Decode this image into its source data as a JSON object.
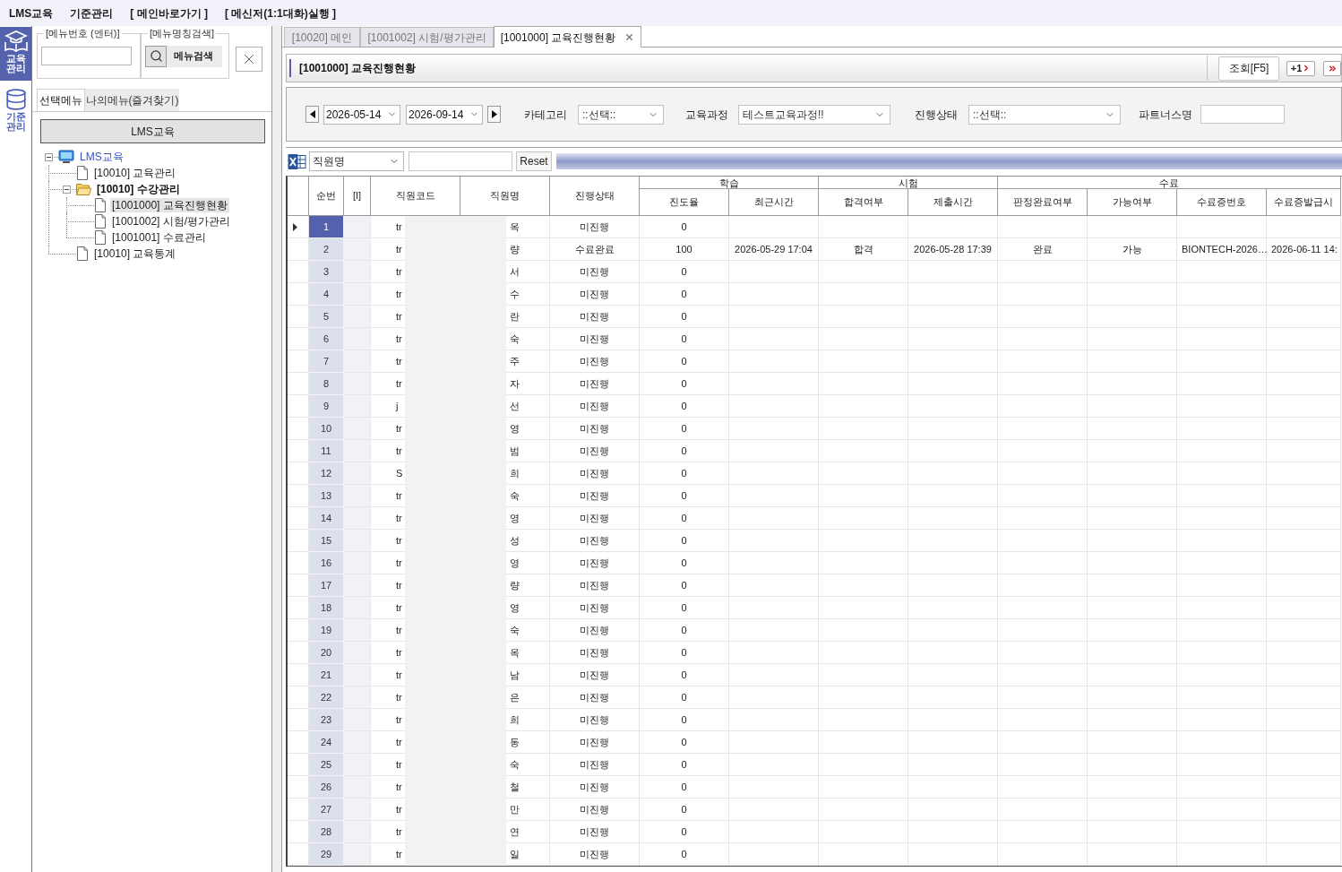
{
  "menubar": [
    "LMS교육",
    "기준관리",
    "[ 메인바로가기 ]",
    "[ 메신저(1:1대화)실행 ]"
  ],
  "nav_rail": [
    {
      "label": "교육관리",
      "selected": true
    },
    {
      "label": "기준관리",
      "selected": false
    }
  ],
  "menu_panel": {
    "menu_number": {
      "label": "[메뉴번호 (엔터)]"
    },
    "menu_search": {
      "label": "[메뉴명칭검색]",
      "button": "메뉴검색"
    },
    "tabs": [
      {
        "label": "선택메뉴",
        "selected": true
      },
      {
        "label": "나의메뉴(즐겨찾기)",
        "selected": false
      }
    ],
    "module_button": "LMS교육",
    "tree": [
      {
        "label": "LMS교육",
        "kind": "root",
        "expanded": true,
        "selected": false,
        "children": [
          {
            "label": "[10010] 교육관리",
            "kind": "page",
            "selected": false
          },
          {
            "label": "[10010] 수강관리",
            "kind": "folder",
            "expanded": true,
            "selected": false,
            "children": [
              {
                "label": "[1001000] 교육진행현황",
                "kind": "page",
                "selected": true
              },
              {
                "label": "[1001002] 시험/평가관리",
                "kind": "page",
                "selected": false
              },
              {
                "label": "[1001001] 수료관리",
                "kind": "page",
                "selected": false
              }
            ]
          },
          {
            "label": "[10010] 교육통계",
            "kind": "page",
            "selected": false
          }
        ]
      }
    ]
  },
  "doc_tabs": [
    {
      "label": "[10020] 메인",
      "selected": false
    },
    {
      "label": "[1001002] 시험/평가관리",
      "selected": false
    },
    {
      "label": "[1001000] 교육진행현황",
      "selected": true
    }
  ],
  "page_header": {
    "title": "[1001000] 교육진행현황",
    "buttons": [
      {
        "kind": "search",
        "label": "조회[F5]"
      },
      {
        "kind": "next",
        "label": "+1"
      },
      {
        "kind": "last"
      }
    ]
  },
  "filters": {
    "date_from": "2026-05-14",
    "date_to": "2026-09-14",
    "fields": [
      {
        "label": "카테고리",
        "kind": "select",
        "value": "::선택::"
      },
      {
        "label": "교육과정",
        "kind": "select",
        "value": "테스트교육과정!!"
      },
      {
        "label": "진행상태",
        "kind": "select",
        "value": "::선택::"
      },
      {
        "label": "파트너스명",
        "kind": "input"
      }
    ]
  },
  "toolbar": {
    "search_column": "직원명",
    "reset_button": "Reset"
  },
  "table": {
    "columns": [
      {
        "label": "순번"
      },
      {
        "label": "[I]"
      },
      {
        "label": "직원코드"
      },
      {
        "label": "직원명"
      },
      {
        "label": "진행상태"
      },
      {
        "group": "학습",
        "columns": [
          {
            "label": "진도율"
          },
          {
            "label": "최근시간"
          }
        ]
      },
      {
        "group": "시험",
        "columns": [
          {
            "label": "합격여부"
          },
          {
            "label": "제출시간"
          }
        ]
      },
      {
        "group": "수료",
        "columns": [
          {
            "label": "판정완료여부"
          },
          {
            "label": "가능여부"
          },
          {
            "label": "수료증번호"
          },
          {
            "label": "수료증발급시"
          }
        ]
      }
    ],
    "rows": [
      {
        "seq": "1",
        "selected": true,
        "code": "tr",
        "name": "옥",
        "status": "미진행",
        "progress": "0"
      },
      {
        "seq": "2",
        "selected": false,
        "code": "tr",
        "name": "량",
        "status": "수료완료",
        "progress": "100",
        "last_time": "2026-05-29 17:04",
        "pass": "합격",
        "submit_time": "2026-05-28 17:39",
        "judged": "완료",
        "eligible": "가능",
        "cert_no": "BIONTECH-2026…",
        "cert_issued": "2026-06-11 14:"
      },
      {
        "seq": "3",
        "selected": false,
        "code": "tr",
        "name": "서",
        "status": "미진행",
        "progress": "0"
      },
      {
        "seq": "4",
        "selected": false,
        "code": "tr",
        "name": "수",
        "status": "미진행",
        "progress": "0"
      },
      {
        "seq": "5",
        "selected": false,
        "code": "tr",
        "name": "란",
        "status": "미진행",
        "progress": "0"
      },
      {
        "seq": "6",
        "selected": false,
        "code": "tr",
        "name": "숙",
        "status": "미진행",
        "progress": "0"
      },
      {
        "seq": "7",
        "selected": false,
        "code": "tr",
        "name": "주",
        "status": "미진행",
        "progress": "0"
      },
      {
        "seq": "8",
        "selected": false,
        "code": "tr",
        "name": "자",
        "status": "미진행",
        "progress": "0"
      },
      {
        "seq": "9",
        "selected": false,
        "code": "j",
        "name": "선",
        "status": "미진행",
        "progress": "0"
      },
      {
        "seq": "10",
        "selected": false,
        "code": "tr",
        "name": "영",
        "status": "미진행",
        "progress": "0"
      },
      {
        "seq": "11",
        "selected": false,
        "code": "tr",
        "name": "범",
        "status": "미진행",
        "progress": "0"
      },
      {
        "seq": "12",
        "selected": false,
        "code": "S",
        "name": "희",
        "status": "미진행",
        "progress": "0"
      },
      {
        "seq": "13",
        "selected": false,
        "code": "tr",
        "name": "숙",
        "status": "미진행",
        "progress": "0"
      },
      {
        "seq": "14",
        "selected": false,
        "code": "tr",
        "name": "영",
        "status": "미진행",
        "progress": "0"
      },
      {
        "seq": "15",
        "selected": false,
        "code": "tr",
        "name": "성",
        "status": "미진행",
        "progress": "0"
      },
      {
        "seq": "16",
        "selected": false,
        "code": "tr",
        "name": "영",
        "status": "미진행",
        "progress": "0"
      },
      {
        "seq": "17",
        "selected": false,
        "code": "tr",
        "name": "량",
        "status": "미진행",
        "progress": "0"
      },
      {
        "seq": "18",
        "selected": false,
        "code": "tr",
        "name": "영",
        "status": "미진행",
        "progress": "0"
      },
      {
        "seq": "19",
        "selected": false,
        "code": "tr",
        "name": "숙",
        "status": "미진행",
        "progress": "0"
      },
      {
        "seq": "20",
        "selected": false,
        "code": "tr",
        "name": "옥",
        "status": "미진행",
        "progress": "0"
      },
      {
        "seq": "21",
        "selected": false,
        "code": "tr",
        "name": "남",
        "status": "미진행",
        "progress": "0"
      },
      {
        "seq": "22",
        "selected": false,
        "code": "tr",
        "name": "은",
        "status": "미진행",
        "progress": "0"
      },
      {
        "seq": "23",
        "selected": false,
        "code": "tr",
        "name": "희",
        "status": "미진행",
        "progress": "0"
      },
      {
        "seq": "24",
        "selected": false,
        "code": "tr",
        "name": "동",
        "status": "미진행",
        "progress": "0"
      },
      {
        "seq": "25",
        "selected": false,
        "code": "tr",
        "name": "숙",
        "status": "미진행",
        "progress": "0"
      },
      {
        "seq": "26",
        "selected": false,
        "code": "tr",
        "name": "철",
        "status": "미진행",
        "progress": "0"
      },
      {
        "seq": "27",
        "selected": false,
        "code": "tr",
        "name": "만",
        "status": "미진행",
        "progress": "0"
      },
      {
        "seq": "28",
        "selected": false,
        "code": "tr",
        "name": "연",
        "status": "미진행",
        "progress": "0"
      },
      {
        "seq": "29",
        "selected": false,
        "code": "tr",
        "name": "일",
        "status": "미진행",
        "progress": "0"
      }
    ]
  }
}
